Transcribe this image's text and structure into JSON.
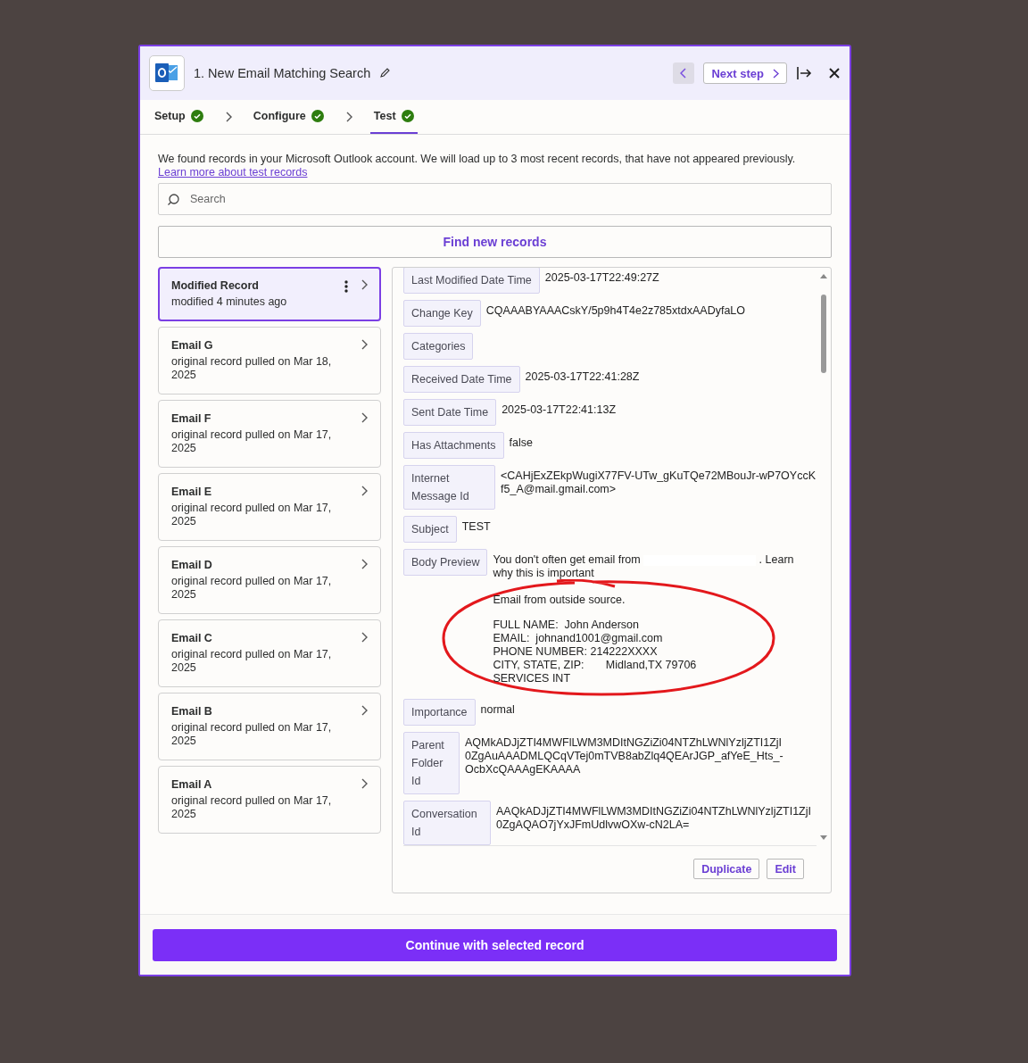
{
  "header": {
    "title": "1. New Email Matching Search",
    "next_label": "Next step"
  },
  "steps": [
    {
      "label": "Setup",
      "done": true,
      "selected": false
    },
    {
      "label": "Configure",
      "done": true,
      "selected": false
    },
    {
      "label": "Test",
      "done": true,
      "selected": true
    }
  ],
  "intro": {
    "text": "We found records in your Microsoft Outlook account. We will load up to 3 most recent records, that have not appeared previously.",
    "link": "Learn more about test records"
  },
  "search": {
    "placeholder": "Search"
  },
  "find_button": "Find new records",
  "records": [
    {
      "title": "Modified Record",
      "subtitle": "modified 4 minutes ago",
      "selected": true
    },
    {
      "title": "Email G",
      "subtitle": "original record pulled on Mar 18, 2025",
      "selected": false
    },
    {
      "title": "Email F",
      "subtitle": "original record pulled on Mar 17, 2025",
      "selected": false
    },
    {
      "title": "Email E",
      "subtitle": "original record pulled on Mar 17, 2025",
      "selected": false
    },
    {
      "title": "Email D",
      "subtitle": "original record pulled on Mar 17, 2025",
      "selected": false
    },
    {
      "title": "Email C",
      "subtitle": "original record pulled on Mar 17, 2025",
      "selected": false
    },
    {
      "title": "Email B",
      "subtitle": "original record pulled on Mar 17, 2025",
      "selected": false
    },
    {
      "title": "Email A",
      "subtitle": "original record pulled on Mar 17, 2025",
      "selected": false
    }
  ],
  "fields": [
    {
      "label": "Last Modified Date Time",
      "value": "2025-03-17T22:49:27Z"
    },
    {
      "label": "Change Key",
      "value": "CQAAABYAAACskY/5p9h4T4e2z785xtdxAADyfaLO"
    },
    {
      "label": "Categories"
    },
    {
      "label": "Received Date Time",
      "value": "2025-03-17T22:41:28Z"
    },
    {
      "label": "Sent Date Time",
      "value": "2025-03-17T22:41:13Z"
    },
    {
      "label": "Has Attachments",
      "value": "false"
    },
    {
      "label": "Internet Message Id",
      "value": "<CAHjExZEkpWugiX77FV-UTw_gKuTQe72MBouJr-wP7OYccKf5_A@mail.gmail.com>"
    },
    {
      "label": "Subject",
      "value": "TEST"
    },
    {
      "label": "Body Preview",
      "kind": "body",
      "intro": "You don't often get email from",
      "intro_end": ". Learn why this is important",
      "lines": [
        "Email from outside source.",
        "FULL NAME:  John Anderson",
        "EMAIL:  johnand1001@gmail.com",
        "PHONE NUMBER: 214222XXXX",
        "CITY, STATE, ZIP:       Midland,TX 79706",
        "SERVICES INT"
      ]
    },
    {
      "label": "Importance",
      "value": "normal"
    },
    {
      "label": "Parent Folder Id",
      "value": "AQMkADJjZTI4MWFlLWM3MDItNGZiZi04NTZhLWNlYzljZTI1ZjI0ZgAuAAADMLQCqVTej0mTVB8abZlq4QEArJGP_afYeE_Hts_-OcbXcQAAAgEKAAAA"
    },
    {
      "label": "Conversation Id",
      "value": "AAQkADJjZTI4MWFlLWM3MDItNGZiZi04NTZhLWNlYzljZTI1ZjI0ZgAQAO7jYxJFmUdlvwOXw-cN2LA="
    }
  ],
  "record_actions": [
    "Duplicate",
    "Edit"
  ],
  "continue_button": "Continue with selected record"
}
